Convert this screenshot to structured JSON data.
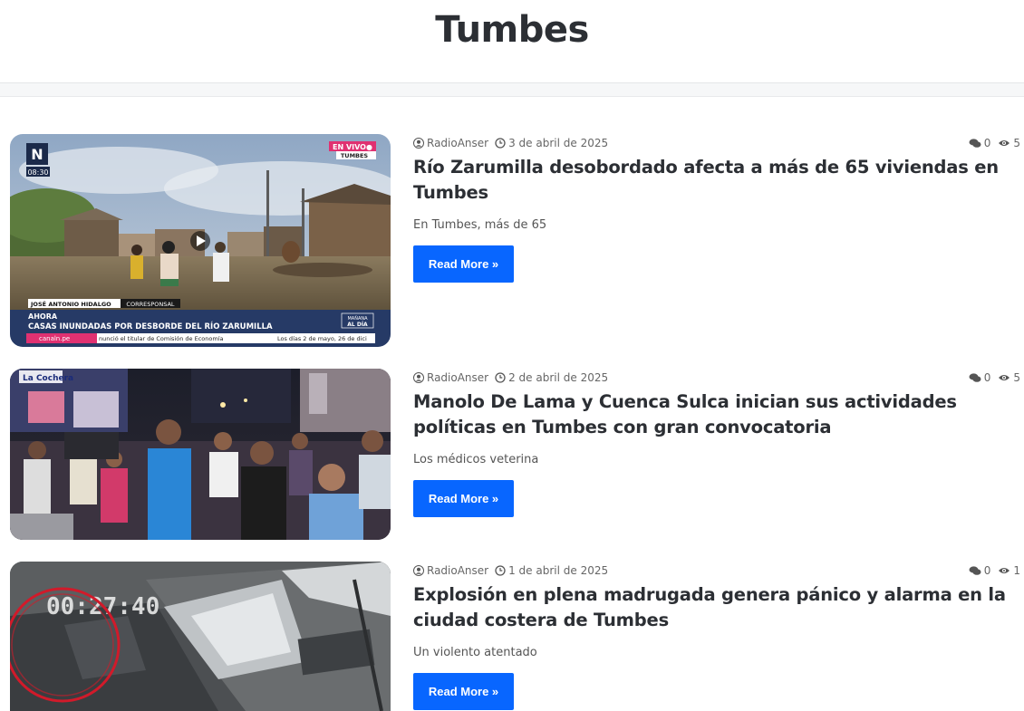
{
  "page": {
    "title": "Tumbes"
  },
  "posts": [
    {
      "author": "RadioAnser",
      "date": "3 de abril de 2025",
      "comments": "0",
      "views": "5",
      "title": "Río Zarumilla desobordado afecta a más de 65 viviendas en Tumbes",
      "excerpt": "En Tumbes, más de 65",
      "read_more": "Read More »",
      "thumb": {
        "live_badge": "EN VIVO●",
        "live_place": "TUMBES",
        "time": "08:30",
        "reporter": "JOSÉ ANTONIO HIDALGO",
        "reporter_role": "CORRESPONSAL",
        "label": "AHORA",
        "headline": "CASAS INUNDADAS POR DESBORDE DEL RÍO ZARUMILLA",
        "show_line1": "MAÑANA",
        "show_line2": "AL DÍA",
        "site": "canaln.pe",
        "ticker1": "nunció el titular de Comisión de Economía",
        "ticker2": "Los días 2 de mayo, 26 de dici"
      }
    },
    {
      "author": "RadioAnser",
      "date": "2 de abril de 2025",
      "comments": "0",
      "views": "5",
      "title": "Manolo De Lama y Cuenca Sulca inician sus actividades políticas en Tumbes con gran convocatoria",
      "excerpt": "Los médicos veterina",
      "read_more": "Read More »",
      "thumb": {
        "shop_sign": "La Cochera"
      }
    },
    {
      "author": "RadioAnser",
      "date": "1 de abril de 2025",
      "comments": "0",
      "views": "1",
      "title": "Explosión en plena madrugada genera pánico y alarma en la ciudad costera de Tumbes",
      "excerpt": "Un violento atentado",
      "read_more": "Read More »",
      "thumb": {
        "cctv_time": "00:27:40"
      }
    }
  ]
}
